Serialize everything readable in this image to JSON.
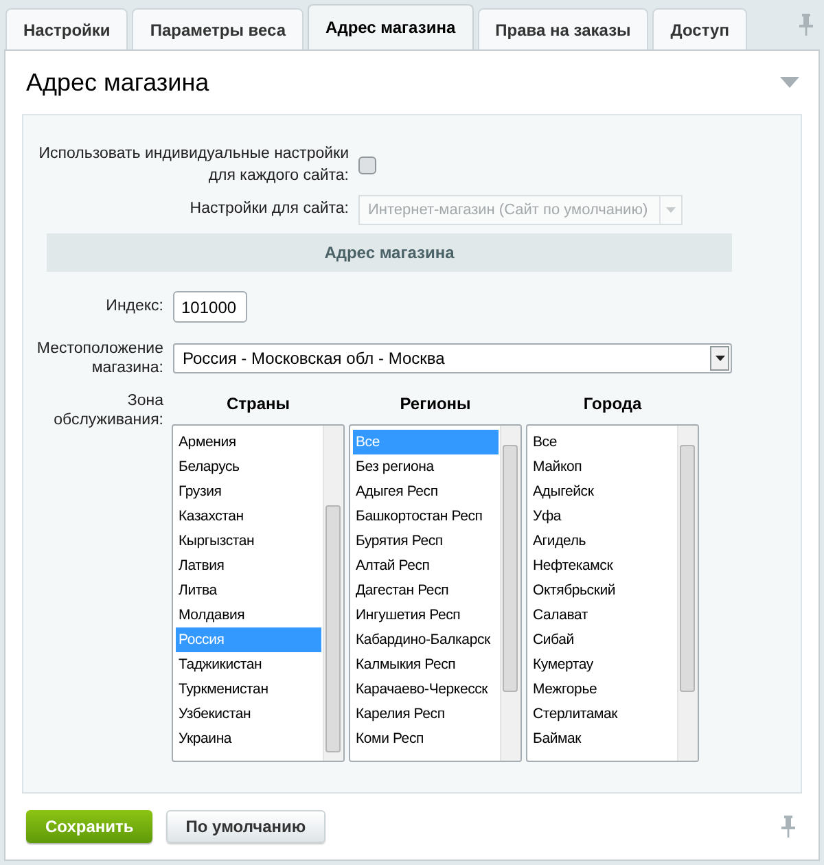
{
  "tabs": [
    {
      "label": "Настройки",
      "selected": false
    },
    {
      "label": "Параметры веса",
      "selected": false
    },
    {
      "label": "Адрес магазина",
      "selected": true
    },
    {
      "label": "Права на заказы",
      "selected": false
    },
    {
      "label": "Доступ",
      "selected": false
    }
  ],
  "panel": {
    "title": "Адрес магазина"
  },
  "individual": {
    "label": "Использовать индивидуальные настройки для каждого сайта:",
    "checked": false
  },
  "site_settings": {
    "label": "Настройки для сайта:",
    "value": "Интернет-магазин (Сайт по умолчанию)",
    "disabled": true
  },
  "section_header": "Адрес магазина",
  "index": {
    "label": "Индекс:",
    "value": "101000"
  },
  "location": {
    "label": "Местоположение магазина:",
    "value": "Россия - Московская обл - Москва"
  },
  "zone": {
    "label": "Зона обслуживания:",
    "lists": [
      {
        "title": "Страны",
        "items": [
          {
            "label": "Армения",
            "selected": false
          },
          {
            "label": "Беларусь",
            "selected": false
          },
          {
            "label": "Грузия",
            "selected": false
          },
          {
            "label": "Казахстан",
            "selected": false
          },
          {
            "label": "Кыргызстан",
            "selected": false
          },
          {
            "label": "Латвия",
            "selected": false
          },
          {
            "label": "Литва",
            "selected": false
          },
          {
            "label": "Молдавия",
            "selected": false
          },
          {
            "label": "Россия",
            "selected": true
          },
          {
            "label": "Таджикистан",
            "selected": false
          },
          {
            "label": "Туркменистан",
            "selected": false
          },
          {
            "label": "Узбекистан",
            "selected": false
          },
          {
            "label": "Украина",
            "selected": false
          }
        ]
      },
      {
        "title": "Регионы",
        "items": [
          {
            "label": "Все",
            "selected": true
          },
          {
            "label": "Без региона",
            "selected": false
          },
          {
            "label": "Адыгея Респ",
            "selected": false
          },
          {
            "label": "Башкортостан Респ",
            "selected": false
          },
          {
            "label": "Бурятия Респ",
            "selected": false
          },
          {
            "label": "Алтай Респ",
            "selected": false
          },
          {
            "label": "Дагестан Респ",
            "selected": false
          },
          {
            "label": "Ингушетия Респ",
            "selected": false
          },
          {
            "label": "Кабардино-Балкарск",
            "selected": false
          },
          {
            "label": "Калмыкия Респ",
            "selected": false
          },
          {
            "label": "Карачаево-Черкесск",
            "selected": false
          },
          {
            "label": "Карелия Респ",
            "selected": false
          },
          {
            "label": "Коми Респ",
            "selected": false
          }
        ]
      },
      {
        "title": "Города",
        "items": [
          {
            "label": "Все",
            "selected": false
          },
          {
            "label": "Майкоп",
            "selected": false
          },
          {
            "label": "Адыгейск",
            "selected": false
          },
          {
            "label": "Уфа",
            "selected": false
          },
          {
            "label": "Агидель",
            "selected": false
          },
          {
            "label": "Нефтекамск",
            "selected": false
          },
          {
            "label": "Октябрьский",
            "selected": false
          },
          {
            "label": "Салават",
            "selected": false
          },
          {
            "label": "Сибай",
            "selected": false
          },
          {
            "label": "Кумертау",
            "selected": false
          },
          {
            "label": "Межгорье",
            "selected": false
          },
          {
            "label": "Стерлитамак",
            "selected": false
          },
          {
            "label": "Баймак",
            "selected": false
          }
        ]
      }
    ]
  },
  "buttons": {
    "save": "Сохранить",
    "default": "По умолчанию"
  }
}
